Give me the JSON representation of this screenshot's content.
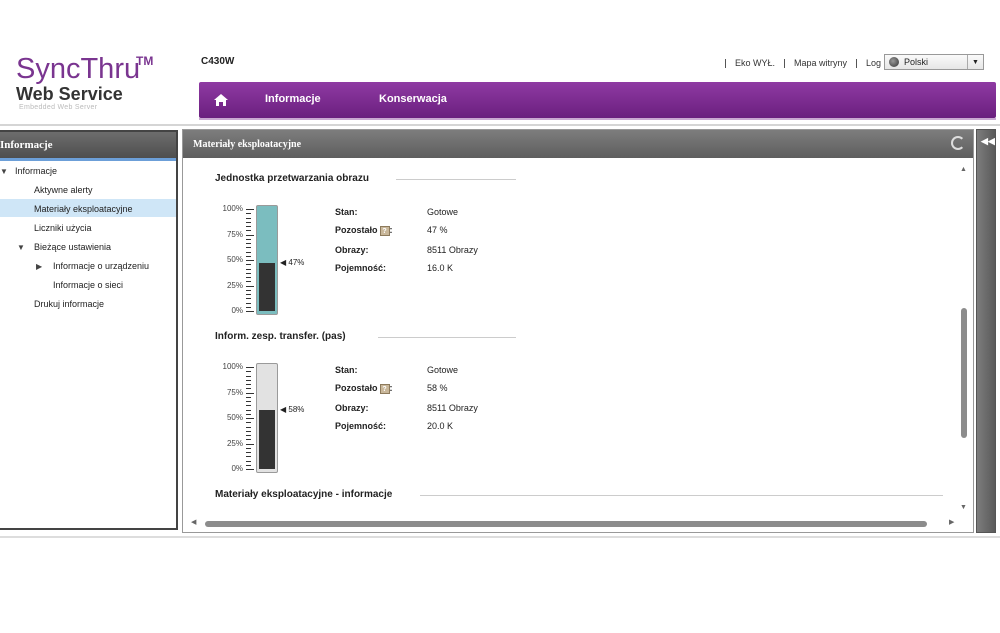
{
  "header": {
    "logo_main": "SyncThru",
    "logo_tm": "TM",
    "logo_sub": "Web Service",
    "logo_tagline": "Embedded Web Server",
    "model": "C430W",
    "links": [
      "Eko WYŁ.",
      "Mapa witryny",
      "Log"
    ],
    "language": "Polski"
  },
  "nav": {
    "home_icon": "home-icon",
    "items": [
      "Informacje",
      "Konserwacja"
    ]
  },
  "sidebar": {
    "title": "Informacje",
    "items": [
      {
        "label": "Informacje",
        "expanded": true
      },
      {
        "label": "Aktywne alerty"
      },
      {
        "label": "Materiały eksploatacyjne",
        "selected": true
      },
      {
        "label": "Liczniki użycia"
      },
      {
        "label": "Bieżące ustawienia",
        "expanded": true
      },
      {
        "label": "Informacje o urządzeniu",
        "collapsed": true
      },
      {
        "label": "Informacje o sieci"
      },
      {
        "label": "Drukuj informacje"
      }
    ]
  },
  "panel": {
    "title": "Materiały eksploatacyjne",
    "refresh_icon": "refresh-icon",
    "collapse_icon": "double-left-arrow-icon",
    "gauge_ticks": [
      "100%",
      "75%",
      "50%",
      "25%",
      "0%"
    ],
    "labels": {
      "status": "Stan:",
      "remaining": "Pozostało",
      "images": "Obrazy:",
      "capacity": "Pojemność:"
    },
    "supplies": [
      {
        "title": "Jednostka przetwarzania obrazu",
        "percent": 47,
        "percent_label": "47%",
        "tube_color": "#7bbdbf",
        "status": "Gotowe",
        "remaining": "47 %",
        "images": "8511 Obrazy",
        "capacity": "16.0 K"
      },
      {
        "title": "Inform. zesp. transfer. (pas)",
        "percent": 58,
        "percent_label": "58%",
        "tube_color": "#e2e2e2",
        "status": "Gotowe",
        "remaining": "58 %",
        "images": "8511 Obrazy",
        "capacity": "20.0 K"
      }
    ],
    "info_section_title": "Materiały eksploatacyjne - informacje"
  }
}
